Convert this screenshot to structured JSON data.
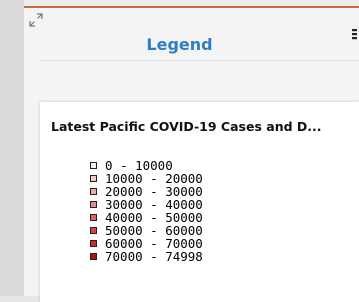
{
  "panel": {
    "title": "Legend"
  },
  "layer": {
    "title": "Latest Pacific COVID-19 Cases and D..."
  },
  "legend_items": [
    {
      "label": "0 - 10000",
      "color": "#f4eeee"
    },
    {
      "label": "10000 - 20000",
      "color": "#f2c9c9"
    },
    {
      "label": "20000 - 30000",
      "color": "#eeabab"
    },
    {
      "label": "30000 - 40000",
      "color": "#e88a8a"
    },
    {
      "label": "40000 - 50000",
      "color": "#e06464"
    },
    {
      "label": "50000 - 60000",
      "color": "#d84444"
    },
    {
      "label": "60000 - 70000",
      "color": "#cc2a2a"
    },
    {
      "label": "70000 - 74998",
      "color": "#b01010"
    }
  ],
  "icons": {
    "expand": "expand-icon",
    "more": "more-options-icon"
  },
  "colors": {
    "accent_border": "#c96a3f",
    "title_blue": "#2f7ec4"
  }
}
